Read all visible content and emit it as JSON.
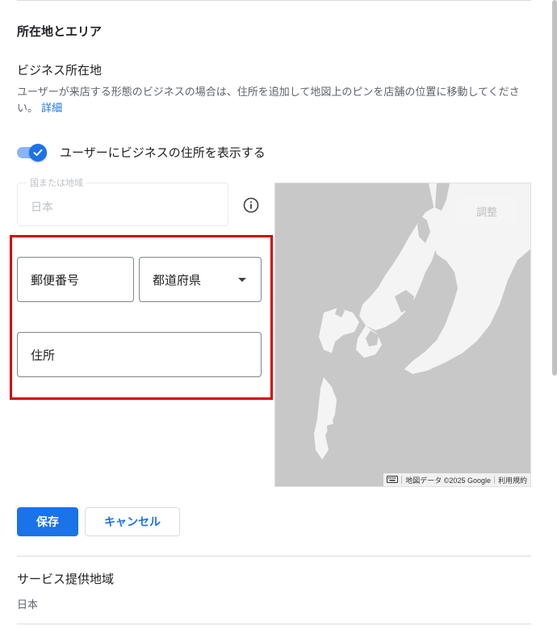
{
  "section": {
    "title": "所在地とエリア"
  },
  "business_location": {
    "title": "ビジネス所在地",
    "description": "ユーザーが来店する形態のビジネスの場合は、住所を追加して地図上のピンを店舗の位置に移動してください。",
    "details_link": "詳細",
    "show_address_toggle": {
      "label": "ユーザーにビジネスの住所を表示する",
      "checked": true
    },
    "country_field": {
      "label": "国または地域",
      "value": "日本"
    },
    "postal_code": {
      "placeholder": "郵便番号"
    },
    "prefecture": {
      "placeholder": "都道府県"
    },
    "address": {
      "placeholder": "住所"
    }
  },
  "map": {
    "adjust_button": "調整",
    "attribution": "地図データ ©2025 Google",
    "terms": "利用規約",
    "icons": [
      "keyboard-icon"
    ]
  },
  "actions": {
    "save": "保存",
    "cancel": "キャンセル"
  },
  "service_area": {
    "title": "サービス提供地域",
    "value": "日本"
  },
  "colors": {
    "primary": "#1a73e8",
    "highlight_border": "#d50000",
    "map_land": "#c8c8c8",
    "map_water": "#f5f5f5"
  }
}
